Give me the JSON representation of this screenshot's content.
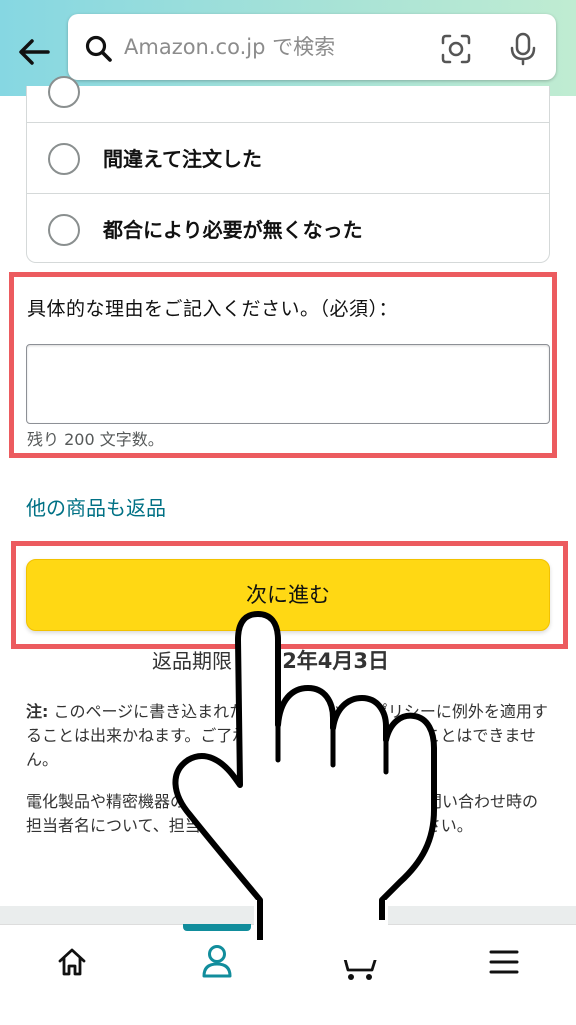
{
  "header": {
    "search_placeholder": "Amazon.co.jp で検索",
    "icons": [
      "back-arrow-icon",
      "search-icon",
      "camera-scan-icon",
      "microphone-icon"
    ]
  },
  "reasons": {
    "options": [
      "間違えて注文した",
      "都合により必要が無くなった"
    ]
  },
  "detail": {
    "label": "具体的な理由をご記入ください。（必須）：",
    "remaining": "残り 200 文字数。"
  },
  "links": {
    "other_items": "他の商品も返品"
  },
  "next_button": {
    "label": "次に進む"
  },
  "deadline": {
    "prefix": "返品期限",
    "date": "2022年4月3日"
  },
  "note": {
    "head": "注:",
    "line1": "このページに書き込まれた内容に基づいて、ポリシーに例外を適用することは出来かねます。ご了承の上、返品手続きを行うことはできません。",
    "line2": "電化製品や精密機器の返品をご希望の場合、メーカーお問い合わせ時の担当者名について、担当者の名前をあわせてご記入ください。"
  },
  "bottom_nav": {
    "icons": [
      "home-icon",
      "account-icon",
      "cart-icon",
      "menu-icon"
    ],
    "cart_count": "0",
    "accent": "#118d9c"
  },
  "colors": {
    "highlight": "#ec5b5f",
    "button": "#ffd814",
    "link": "#007185"
  }
}
